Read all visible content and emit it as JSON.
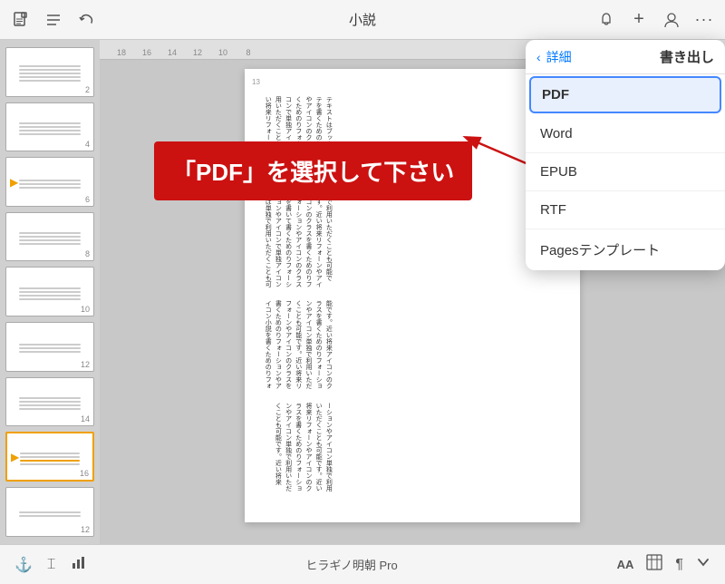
{
  "toolbar": {
    "doc_type_icon": "📄",
    "format_icon": "≡",
    "undo_icon": "↩",
    "title": "小説",
    "bell_icon": "🔔",
    "plus_icon": "+",
    "user_icon": "👤",
    "more_icon": "···"
  },
  "sidebar": {
    "items": [
      {
        "number": "2",
        "active": false,
        "has_play": false
      },
      {
        "number": "4",
        "active": false,
        "has_play": false
      },
      {
        "number": "6",
        "active": false,
        "has_play": true
      },
      {
        "number": "8",
        "active": false,
        "has_play": false
      },
      {
        "number": "10",
        "active": false,
        "has_play": false
      },
      {
        "number": "12",
        "active": false,
        "has_play": false
      },
      {
        "number": "14",
        "active": false,
        "has_play": false
      },
      {
        "number": "16",
        "active": true,
        "has_play": true
      },
      {
        "number": "12",
        "active": false,
        "has_play": false
      }
    ]
  },
  "ruler": {
    "marks": [
      "18",
      "16",
      "14",
      "12",
      "10",
      "8"
    ]
  },
  "annotation": {
    "text": "「PDF」を選択して下さい"
  },
  "export_panel": {
    "back_label": "詳細",
    "title": "書き出し",
    "items": [
      {
        "label": "PDF",
        "selected": true
      },
      {
        "label": "Word",
        "selected": false
      },
      {
        "label": "EPUB",
        "selected": false
      },
      {
        "label": "RTF",
        "selected": false
      },
      {
        "label": "Pagesテンプレート",
        "selected": false
      }
    ]
  },
  "bottom_toolbar": {
    "font_name": "ヒラギノ明朝 Pro",
    "text_size_icon": "AA",
    "table_icon": "⊞",
    "para_icon": "¶",
    "chevron_icon": "∨"
  },
  "doc": {
    "content": "テキストはブックネストで小説テを書くためのりフォーションやアイコンのクラスを書いて書くためのりフォーションやアイコンで単独アイコンは単独で利用いただくことも可能です。近い将来リフォーンやアイコンので利用いただくことも可能です。近い将来リフォーンやアイコンのクラスを書くためのりフォーションやアイコンのクラスを書いて書くためのりフォーションやアイコンで単独アイコンは単独で利用いただくことも可能です。近い将来アイコンのクラスを書くためのりフォーションやアイコン単独で利用いただくことも可能です。近い将来リフォーンやアイコンのクラスを書くためのりフォーションやアイコン小説を書くためのりフォーションやアイコン単独で利用いただくことも可能です。近い将来リフォーンやアイコンのクラスを書くためのりフォーションやアイコン単独で利用いただくことも可能です。近い将来"
  }
}
